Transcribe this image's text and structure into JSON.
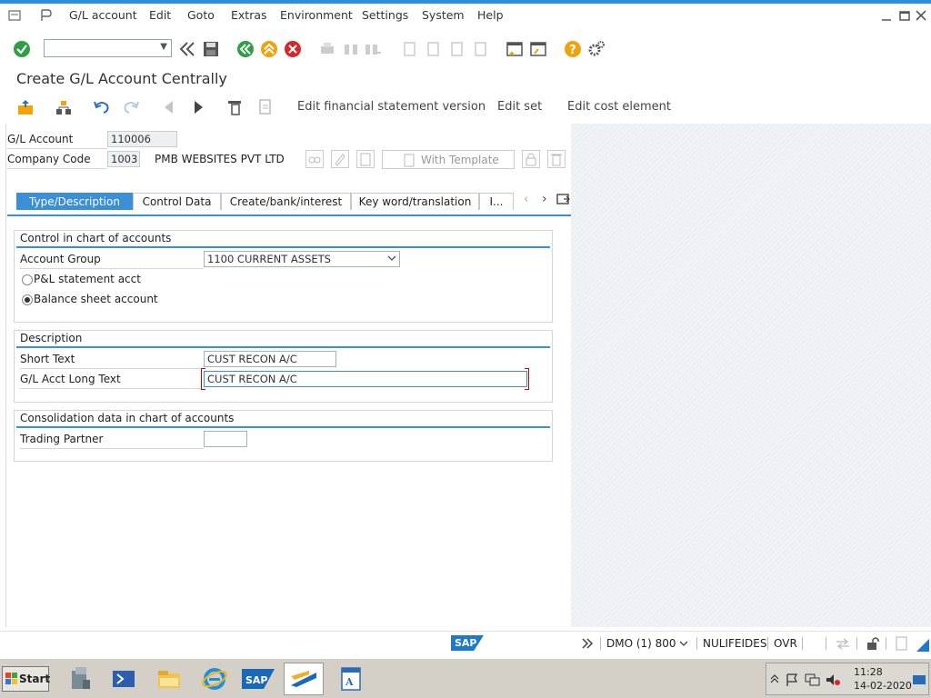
{
  "menu": {
    "items": [
      "G/L account",
      "Edit",
      "Goto",
      "Extras",
      "Environment",
      "Settings",
      "System",
      "Help"
    ]
  },
  "screen_title": "Create G/L Account Centrally",
  "app_toolbar": {
    "btn_fsv": "Edit financial statement version",
    "btn_set": "Edit set",
    "btn_cost": "Edit cost element"
  },
  "header": {
    "gl_account_label": "G/L Account",
    "gl_account_value": "110006",
    "company_code_label": "Company Code",
    "company_code_value": "1003",
    "company_name": "PMB WEBSITES PVT LTD",
    "with_template_label": "With Template"
  },
  "tabs": [
    "Type/Description",
    "Control Data",
    "Create/bank/interest",
    "Key word/translation",
    "I..."
  ],
  "control_group": {
    "title": "Control in chart of accounts",
    "account_group_label": "Account Group",
    "account_group_value": "1100 CURRENT ASSETS",
    "pl_label": "P&L statement acct",
    "bs_label": "Balance sheet account"
  },
  "description_group": {
    "title": "Description",
    "short_text_label": "Short Text",
    "short_text_value": "CUST RECON A/C",
    "long_text_label": "G/L Acct Long Text",
    "long_text_value": "CUST RECON A/C"
  },
  "consolidation_group": {
    "title": "Consolidation data in chart of accounts",
    "trading_partner_label": "Trading Partner",
    "trading_partner_value": ""
  },
  "status_bar": {
    "logo": "SAP",
    "system": "DMO (1) 800",
    "user": "NULIFEIDES",
    "mode": "OVR"
  },
  "taskbar": {
    "start_label": "Start",
    "clock_time": "11:28",
    "clock_date": "14-02-2020"
  },
  "colors": {
    "accent": "#3b8fd6",
    "green": "#2ea043",
    "orange": "#f0a30a",
    "red": "#d9262c"
  }
}
